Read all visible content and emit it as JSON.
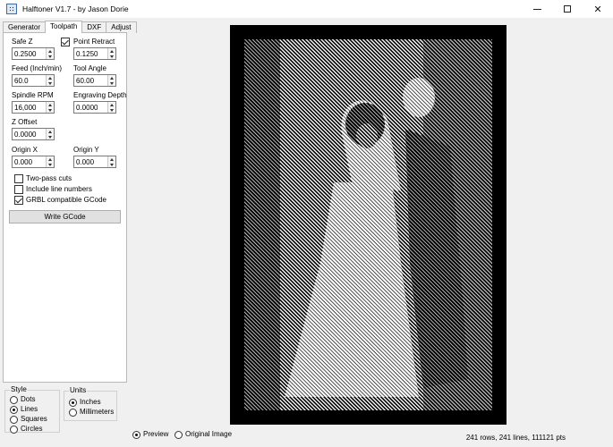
{
  "window": {
    "title": "Halftoner V1.7 - by Jason Dorie",
    "minimize_icon": "minimize-icon",
    "maximize_icon": "maximize-icon",
    "close_glyph": "✕"
  },
  "tabs": [
    {
      "label": "Generator",
      "active": false
    },
    {
      "label": "Toolpath",
      "active": true
    },
    {
      "label": "DXF",
      "active": false
    },
    {
      "label": "Adjust",
      "active": false
    }
  ],
  "toolpath": {
    "safe_z": {
      "label": "Safe Z",
      "value": "0.2500"
    },
    "point_retract": {
      "label": "Point Retract",
      "checked": true
    },
    "point_retract_value": "0.1250",
    "feed": {
      "label": "Feed (Inch/min)",
      "value": "60.0"
    },
    "tool_angle": {
      "label": "Tool Angle",
      "value": "60.00"
    },
    "spindle_rpm": {
      "label": "Spindle RPM",
      "value": "16,000"
    },
    "engraving_depth": {
      "label": "Engraving Depth",
      "value": "0.0000"
    },
    "z_offset": {
      "label": "Z Offset",
      "value": "0.0000"
    },
    "origin_x": {
      "label": "Origin X",
      "value": "0.000"
    },
    "origin_y": {
      "label": "Origin Y",
      "value": "0.000"
    },
    "two_pass_cuts": {
      "label": "Two-pass cuts",
      "checked": false
    },
    "include_line_numbers": {
      "label": "Include line numbers",
      "checked": false
    },
    "grbl_compatible": {
      "label": "GRBL compatible GCode",
      "checked": true
    },
    "write_gcode_label": "Write GCode"
  },
  "style_group": {
    "title": "Style",
    "options": [
      {
        "label": "Dots",
        "checked": false
      },
      {
        "label": "Lines",
        "checked": true
      },
      {
        "label": "Squares",
        "checked": false
      },
      {
        "label": "Circles",
        "checked": false
      }
    ]
  },
  "units_group": {
    "title": "Units",
    "options": [
      {
        "label": "Inches",
        "checked": true
      },
      {
        "label": "Millimeters",
        "checked": false
      }
    ]
  },
  "view_mode": {
    "options": [
      {
        "label": "Preview",
        "checked": true
      },
      {
        "label": "Original Image",
        "checked": false
      }
    ]
  },
  "status": {
    "text": "241 rows, 241 lines, 111121 pts"
  },
  "colors": {
    "panel_bg": "#f0f0f0",
    "preview_bg": "#000000",
    "line_color": "#ffffff"
  }
}
